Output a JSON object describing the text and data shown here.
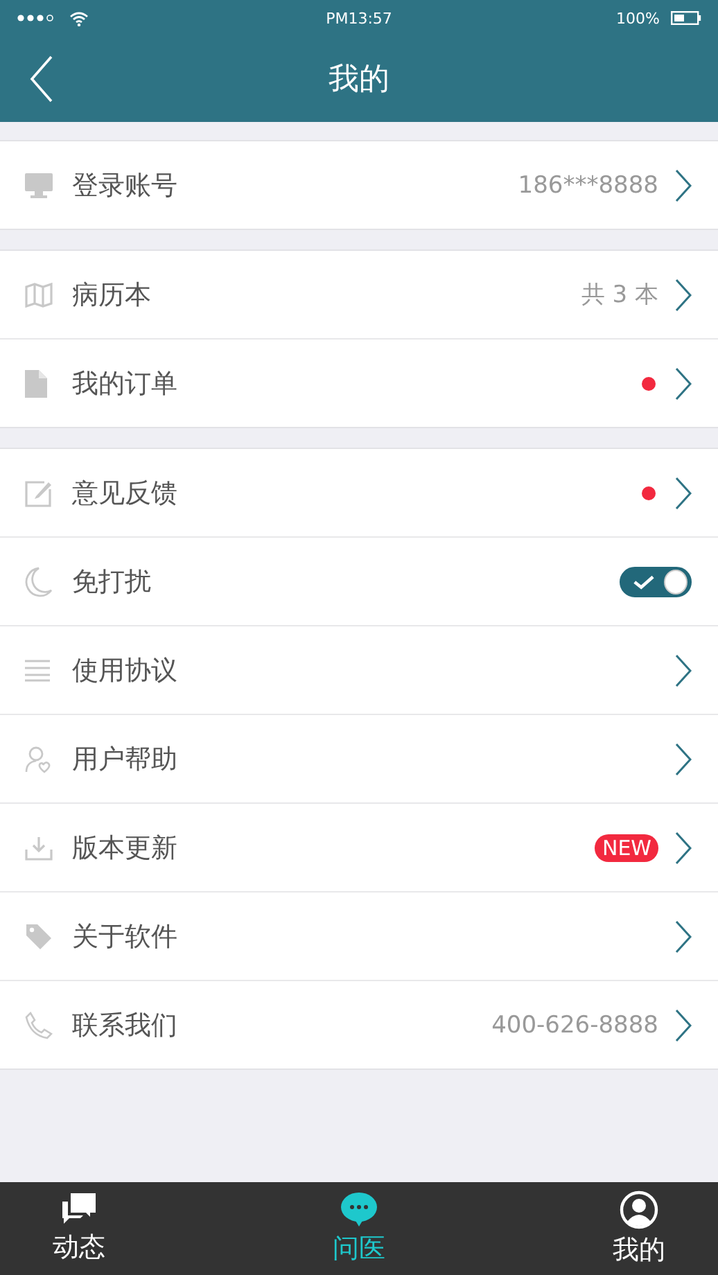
{
  "status_bar": {
    "time": "PM13:57",
    "battery": "100%"
  },
  "header": {
    "title": "我的"
  },
  "groups": [
    {
      "rows": [
        {
          "kind": "link",
          "label": "登录账号",
          "value": "186***8888",
          "dot": false
        }
      ]
    },
    {
      "rows": [
        {
          "kind": "link",
          "label": "病历本",
          "value": "共 3 本",
          "dot": false
        },
        {
          "kind": "link",
          "label": "我的订单",
          "dot": true
        }
      ]
    },
    {
      "rows": [
        {
          "kind": "link",
          "label": "意见反馈",
          "dot": true
        },
        {
          "kind": "toggle",
          "label": "免打扰",
          "on": true
        },
        {
          "kind": "link",
          "label": "使用协议",
          "dot": false
        },
        {
          "kind": "link",
          "label": "用户帮助",
          "dot": false
        },
        {
          "kind": "link",
          "label": "版本更新",
          "badge": "NEW",
          "dot": false
        },
        {
          "kind": "link",
          "label": "关于软件",
          "dot": false
        },
        {
          "kind": "link",
          "label": "联系我们",
          "value": "400-626-8888",
          "dot": false
        }
      ]
    }
  ],
  "tabs": [
    {
      "label": "动态",
      "selected": false
    },
    {
      "label": "问医",
      "selected": true
    },
    {
      "label": "我的",
      "selected": false
    }
  ]
}
